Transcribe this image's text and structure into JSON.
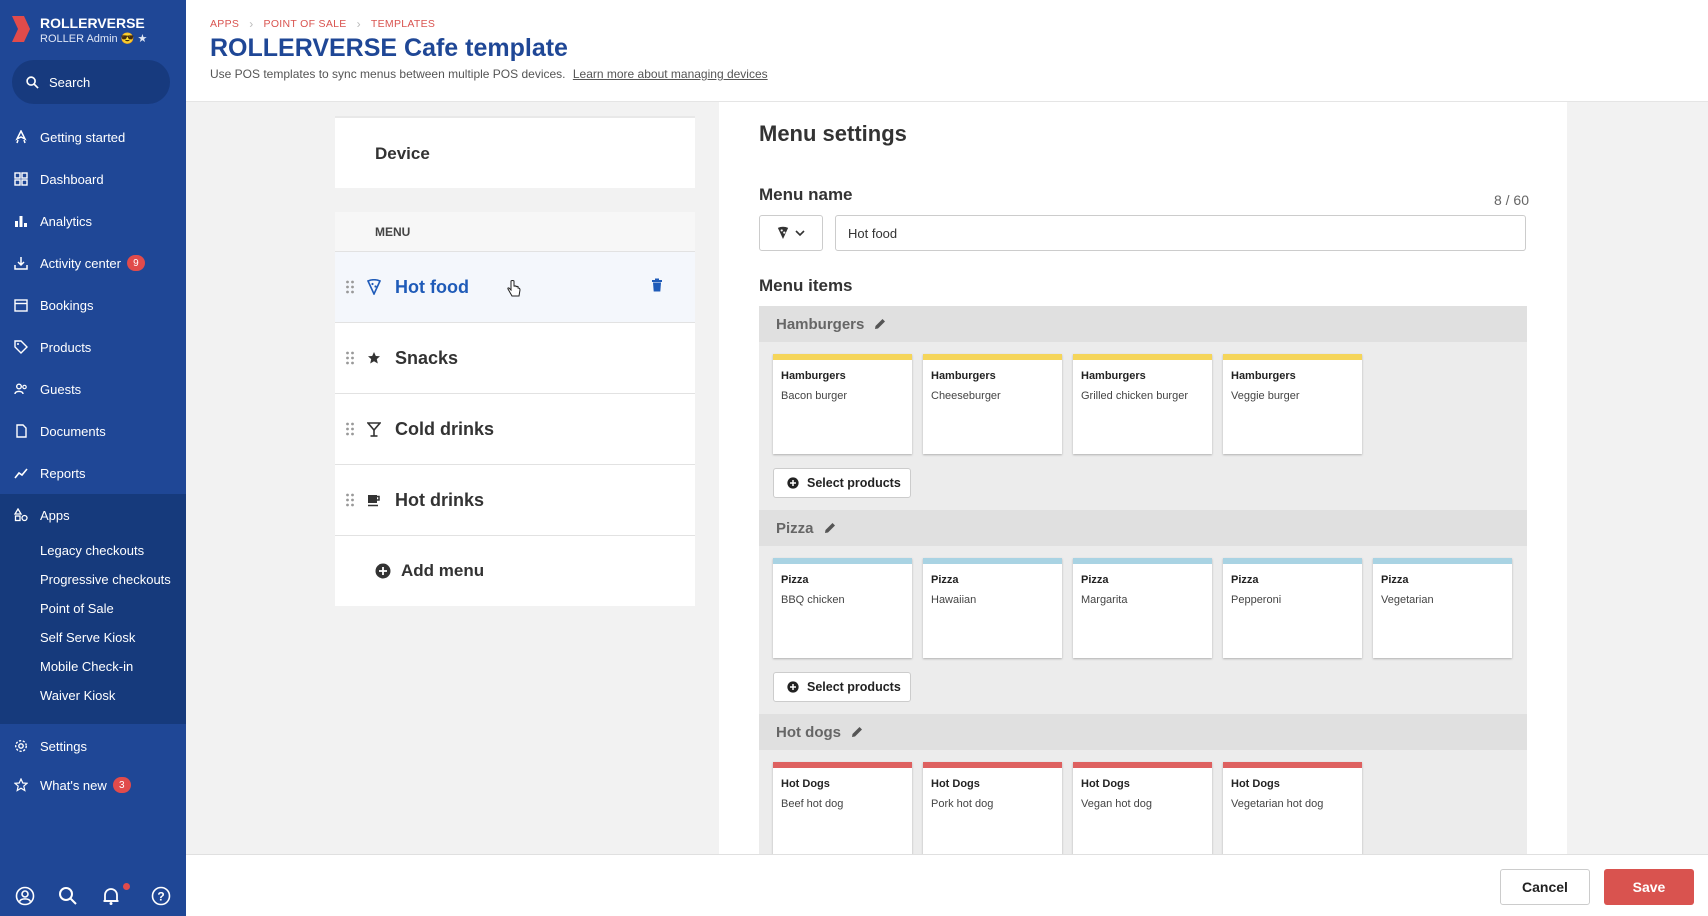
{
  "brand": {
    "name": "ROLLERVERSE",
    "subtitle": "ROLLER Admin 😎 ★"
  },
  "search": {
    "label": "Search"
  },
  "nav": {
    "getting_started": "Getting started",
    "dashboard": "Dashboard",
    "analytics": "Analytics",
    "activity_center": "Activity center",
    "activity_badge": "9",
    "bookings": "Bookings",
    "products": "Products",
    "guests": "Guests",
    "documents": "Documents",
    "reports": "Reports",
    "apps": "Apps",
    "apps_sub": [
      "Legacy checkouts",
      "Progressive checkouts",
      "Point of Sale",
      "Self Serve Kiosk",
      "Mobile Check-in",
      "Waiver Kiosk"
    ],
    "settings": "Settings",
    "whats_new": "What's new",
    "whats_new_badge": "3"
  },
  "header": {
    "breadcrumb": [
      "APPS",
      "POINT OF SALE",
      "TEMPLATES"
    ],
    "title": "ROLLERVERSE Cafe template",
    "subtitle": "Use POS templates to sync menus between multiple POS devices.",
    "link": "Learn more about managing devices"
  },
  "device": {
    "label": "Device"
  },
  "menu": {
    "header": "MENU",
    "items": [
      "Hot food",
      "Snacks",
      "Cold drinks",
      "Hot drinks"
    ],
    "add_label": "Add menu"
  },
  "settings": {
    "title": "Menu settings",
    "name_label": "Menu name",
    "counter": "8 / 60",
    "name_value": "Hot food",
    "items_label": "Menu items",
    "select_products": "Select products",
    "groups": [
      {
        "name": "Hamburgers",
        "color": "#f5d55a",
        "cards": [
          {
            "cat": "Hamburgers",
            "prod": "Bacon burger"
          },
          {
            "cat": "Hamburgers",
            "prod": "Cheeseburger"
          },
          {
            "cat": "Hamburgers",
            "prod": "Grilled chicken burger"
          },
          {
            "cat": "Hamburgers",
            "prod": "Veggie burger"
          }
        ]
      },
      {
        "name": "Pizza",
        "color": "#a9d3e3",
        "cards": [
          {
            "cat": "Pizza",
            "prod": "BBQ chicken"
          },
          {
            "cat": "Pizza",
            "prod": "Hawaiian"
          },
          {
            "cat": "Pizza",
            "prod": "Margarita"
          },
          {
            "cat": "Pizza",
            "prod": "Pepperoni"
          },
          {
            "cat": "Pizza",
            "prod": "Vegetarian"
          }
        ]
      },
      {
        "name": "Hot dogs",
        "color": "#de6160",
        "cards": [
          {
            "cat": "Hot Dogs",
            "prod": "Beef hot dog"
          },
          {
            "cat": "Hot Dogs",
            "prod": "Pork hot dog"
          },
          {
            "cat": "Hot Dogs",
            "prod": "Vegan hot dog"
          },
          {
            "cat": "Hot Dogs",
            "prod": "Vegetarian hot dog"
          }
        ]
      }
    ]
  },
  "footer": {
    "cancel": "Cancel",
    "save": "Save"
  },
  "colors": {
    "sidebar": "#1f4796",
    "accent": "#d9534f",
    "title": "#1f4796"
  }
}
